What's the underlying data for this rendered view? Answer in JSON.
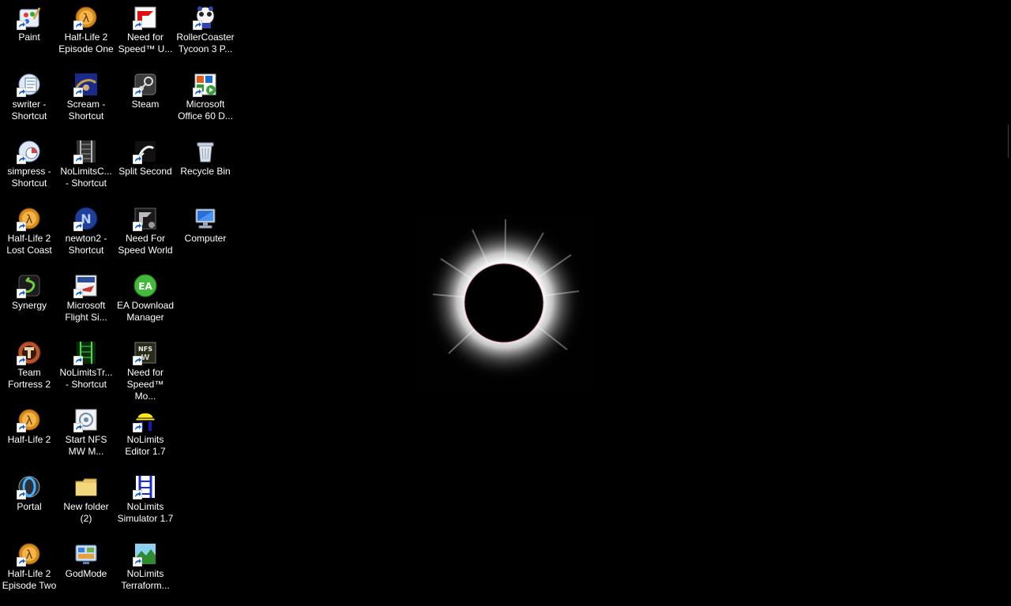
{
  "desktop": {
    "background_color": "#000000",
    "wallpaper": "solar-eclipse",
    "icons": [
      {
        "label": "Paint",
        "icon": "paint-icon",
        "shortcut": true
      },
      {
        "label": "swriter -\nShortcut",
        "icon": "writer-icon",
        "shortcut": true
      },
      {
        "label": "simpress -\nShortcut",
        "icon": "impress-icon",
        "shortcut": true
      },
      {
        "label": "Half-Life 2\nLost Coast",
        "icon": "half-life-icon",
        "shortcut": true
      },
      {
        "label": "Synergy",
        "icon": "synergy-icon",
        "shortcut": true
      },
      {
        "label": "Team\nFortress 2",
        "icon": "team-fortress-icon",
        "shortcut": true
      },
      {
        "label": "Half-Life 2",
        "icon": "half-life-icon",
        "shortcut": true
      },
      {
        "label": "Portal",
        "icon": "portal-icon",
        "shortcut": true
      },
      {
        "label": "Half-Life 2\nEpisode Two",
        "icon": "half-life-icon",
        "shortcut": true
      },
      {
        "label": "Half-Life 2\nEpisode One",
        "icon": "half-life-icon",
        "shortcut": true
      },
      {
        "label": "Scream -\nShortcut",
        "icon": "scream-icon",
        "shortcut": true
      },
      {
        "label": "NoLimitsC...\n- Shortcut",
        "icon": "coaster-track-icon",
        "shortcut": true
      },
      {
        "label": "newton2 -\nShortcut",
        "icon": "newton-icon",
        "shortcut": true
      },
      {
        "label": "Microsoft\nFlight Si...",
        "icon": "flight-sim-icon",
        "shortcut": true
      },
      {
        "label": "NoLimitsTr...\n- Shortcut",
        "icon": "green-track-icon",
        "shortcut": true
      },
      {
        "label": "Start NFS\nMW M...",
        "icon": "nfs-mod-icon",
        "shortcut": true
      },
      {
        "label": "New folder\n(2)",
        "icon": "folder-icon",
        "shortcut": false
      },
      {
        "label": "GodMode",
        "icon": "control-panel-icon",
        "shortcut": false
      },
      {
        "label": "Need for\nSpeed™ U...",
        "icon": "nfs-undercover-icon",
        "shortcut": true
      },
      {
        "label": "Steam",
        "icon": "steam-icon",
        "shortcut": true
      },
      {
        "label": "Split Second",
        "icon": "split-second-icon",
        "shortcut": true
      },
      {
        "label": "Need For\nSpeed World",
        "icon": "nfs-world-icon",
        "shortcut": true
      },
      {
        "label": "EA Download\nManager",
        "icon": "ea-icon",
        "shortcut": false
      },
      {
        "label": "Need for\nSpeed™ Mo...",
        "icon": "nfs-mostwanted-icon",
        "shortcut": true
      },
      {
        "label": "NoLimits\nEditor 1.7",
        "icon": "nolimits-editor-icon",
        "shortcut": true
      },
      {
        "label": "NoLimits\nSimulator 1.7",
        "icon": "nolimits-sim-icon",
        "shortcut": true
      },
      {
        "label": "NoLimits\nTerraform...",
        "icon": "terraform-icon",
        "shortcut": true
      },
      {
        "label": "RollerCoaster\nTycoon 3 P...",
        "icon": "rct3-icon",
        "shortcut": true
      },
      {
        "label": "Microsoft\nOffice 60 D...",
        "icon": "office-trial-icon",
        "shortcut": true
      },
      {
        "label": "Recycle Bin",
        "icon": "recycle-bin-icon",
        "shortcut": false
      },
      {
        "label": "Computer",
        "icon": "computer-icon",
        "shortcut": false
      }
    ]
  }
}
